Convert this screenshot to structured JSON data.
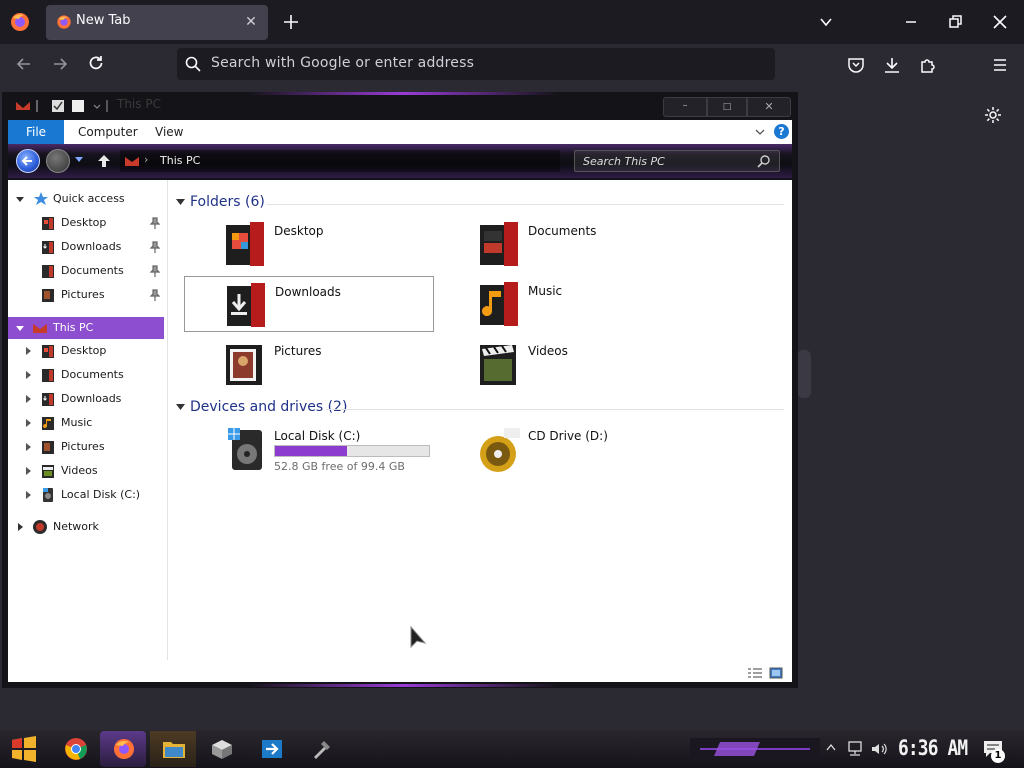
{
  "browser": {
    "tab": {
      "title": "New Tab"
    },
    "urlbar": {
      "placeholder": "Search with Google or enter address"
    },
    "accent": "#fbfbfe"
  },
  "explorer": {
    "quick_access_title": "This PC",
    "ribbon": {
      "file": "File",
      "computer": "Computer",
      "view": "View"
    },
    "address": {
      "path": "This PC"
    },
    "search": {
      "placeholder": "Search This PC"
    },
    "nav": {
      "quick_access": "Quick access",
      "quick_items": [
        "Desktop",
        "Downloads",
        "Documents",
        "Pictures"
      ],
      "this_pc": "This PC",
      "this_pc_items": [
        "Desktop",
        "Documents",
        "Downloads",
        "Music",
        "Pictures",
        "Videos",
        "Local Disk (C:)"
      ],
      "network": "Network"
    },
    "folders_header": "Folders (6)",
    "folders": [
      "Desktop",
      "Documents",
      "Downloads",
      "Music",
      "Pictures",
      "Videos"
    ],
    "devices_header": "Devices and drives (2)",
    "drives": [
      {
        "name": "Local Disk (C:)",
        "free_text": "52.8 GB free of 99.4 GB",
        "used_fraction": 0.469
      },
      {
        "name": "CD Drive (D:)"
      }
    ],
    "selection_color": "#8d4ecf"
  },
  "taskbar": {
    "clock": "6:36 AM",
    "notification_count": "1"
  }
}
